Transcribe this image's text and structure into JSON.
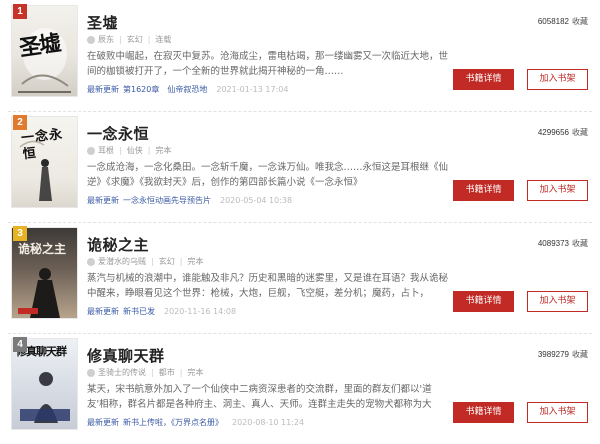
{
  "colors": {
    "accent": "#c22a25",
    "rank1": "#c5332b",
    "rank2": "#e07a2e",
    "rank3": "#e6b325",
    "rank4": "#7a7a7a",
    "link": "#3b5ba5"
  },
  "labels": {
    "latest": "最新更新",
    "detail_button": "书籍详情",
    "shelf_button": "加入书架",
    "collect": "收藏"
  },
  "books": [
    {
      "rank": "1",
      "cover_text": "圣墟",
      "title": "圣墟",
      "author": "辰东",
      "category": "玄幻",
      "status": "连载",
      "desc": "在破败中崛起，在寂灭中复苏。沧海成尘，雷电枯竭，那一缕幽雾又一次临近大地，世间的枷锁被打开了，一个全新的世界就此揭开神秘的一角……",
      "latest_chapter": "第1620章　仙帝叙恐地",
      "time": "2021-01-13 17:04",
      "count": "6058182"
    },
    {
      "rank": "2",
      "cover_text": "一念永恒",
      "title": "一念永恒",
      "author": "耳根",
      "category": "仙侠",
      "status": "完本",
      "desc": "一念成沧海，一念化桑田。一念斩千魔，一念诛万仙。唯我念……永恒这是耳根继《仙逆》《求魔》《我欲封天》后，创作的第四部长篇小说《一念永恒》",
      "latest_chapter": "一念永恒动画先导预告片",
      "time": "2020-05-04 10:38",
      "count": "4299656"
    },
    {
      "rank": "3",
      "cover_text": "诡秘之主",
      "title": "诡秘之主",
      "author": "爱潜水的乌贼",
      "category": "玄幻",
      "status": "完本",
      "desc": "蒸汽与机械的浪潮中，谁能触及非凡？历史和黑暗的迷雾里，又是谁在耳语？我从诡秘中醒来，睁眼看见这个世界：枪械，大炮，巨舰，飞空艇，差分机；魔药，占卜，",
      "latest_chapter": "新书已发",
      "time": "2020-11-16 14:08",
      "count": "4089373"
    },
    {
      "rank": "4",
      "cover_text": "修真聊天群",
      "title": "修真聊天群",
      "author": "圣骑士的传说",
      "category": "都市",
      "status": "完本",
      "desc": "某天，宋书航意外加入了一个仙侠中二病资深患者的交流群，里面的群友们都以'道友'相称，群名片都是各种府主、洞主、真人、天师。连群主走失的宠物犬都称为大",
      "latest_chapter": "新书上传啦，《万界点名册》",
      "time": "2020-08-10 11:24",
      "count": "3989279"
    }
  ]
}
